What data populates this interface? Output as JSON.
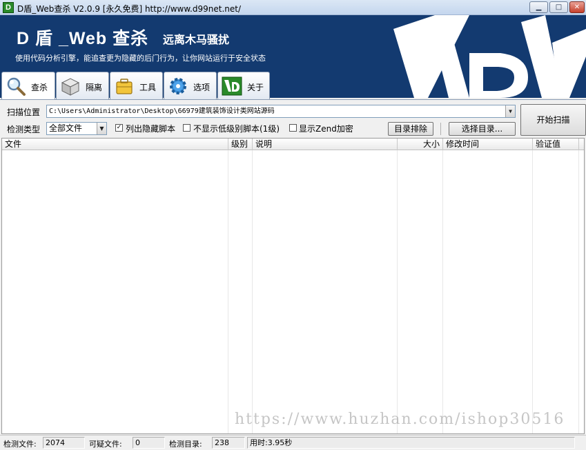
{
  "window": {
    "title": "D盾_Web查杀 V2.0.9 [永久免费] http://www.d99net.net/",
    "icon_letter": "D",
    "min_glyph": "▁",
    "max_glyph": "□",
    "close_glyph": "✕"
  },
  "banner": {
    "title": "D 盾 _Web 查杀",
    "slogan": "远离木马骚扰",
    "subtitle": "使用代码分析引擎，能追查更为隐藏的后门行为，让你网站运行于安全状态"
  },
  "tabs": [
    {
      "label": "查杀",
      "icon": "magnifier-icon",
      "active": true
    },
    {
      "label": "隔离",
      "icon": "box-icon",
      "active": false
    },
    {
      "label": "工具",
      "icon": "briefcase-icon",
      "active": false
    },
    {
      "label": "选项",
      "icon": "gear-icon",
      "active": false
    },
    {
      "label": "关于",
      "icon": "d-logo-icon",
      "active": false
    }
  ],
  "scan": {
    "location_label": "扫描位置",
    "location_value": "C:\\Users\\Administrator\\Desktop\\66979建筑装饰设计类网站源码",
    "type_label": "检测类型",
    "type_value": "全部文件",
    "checkbox_hidden": {
      "label": "列出隐藏脚本",
      "checked": true
    },
    "checkbox_lowlevel": {
      "label": "不显示低级别脚本(1级)",
      "checked": false
    },
    "checkbox_zend": {
      "label": "显示Zend加密",
      "checked": false
    },
    "exclude_button": "目录排除",
    "choose_button": "选择目录...",
    "start_button": "开始扫描",
    "check_glyph": "✓",
    "dropdown_glyph": "▼"
  },
  "table": {
    "columns": [
      "文件",
      "级别",
      "说明",
      "大小",
      "修改时间",
      "验证值"
    ],
    "rows": []
  },
  "watermark": "https://www.huzhan.com/ishop30516",
  "status": {
    "files_label": "检测文件:",
    "files_value": "2074",
    "suspicious_label": "可疑文件:",
    "suspicious_value": "0",
    "dirs_label": "检测目录:",
    "dirs_value": "238",
    "time_value": "用时:3.95秒"
  },
  "colors": {
    "banner_bg": "#133a70",
    "accent_green": "#2a8a2a"
  }
}
